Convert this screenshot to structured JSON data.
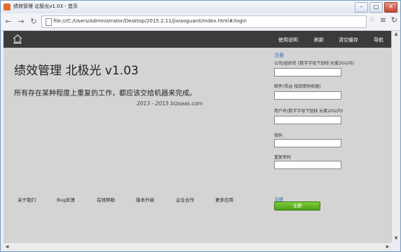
{
  "window": {
    "title": "绩效管理 北极光v1.03 - 首页"
  },
  "browser": {
    "url": "file:///C:/Users/Administrator/Desktop/2015.2.11/jixiaoguanli/index.html#/login"
  },
  "header": {
    "nav": [
      "使用说明",
      "刷新",
      "清空缓存",
      "导航"
    ]
  },
  "hero": {
    "title": "绩效管理 北极光 v1.03",
    "tagline": "所有存在某种程度上重复的工作，都应该交给机器来完成。",
    "copyright": "2013 - 2015 bizsaas.com"
  },
  "form": {
    "title": "注册",
    "fields": [
      {
        "label": "公司/组织名 (数字字母下划线 长度20以内)",
        "value": ""
      },
      {
        "label": "邮件(带@ 找回密码依据)",
        "value": ""
      },
      {
        "label": "用户名(数字字母下划线 长度20以内)",
        "value": ""
      },
      {
        "label": "密码",
        "value": ""
      },
      {
        "label": "重复密码",
        "value": ""
      }
    ],
    "submit_label": "注册",
    "submit_button": "注册",
    "accent_color": "#2a6ebb",
    "button_color": "#5cae22"
  },
  "footer": {
    "links": [
      "关于我们",
      "Bug反馈",
      "在线帮助",
      "版本升级",
      "企业合作",
      "更多应用"
    ]
  }
}
